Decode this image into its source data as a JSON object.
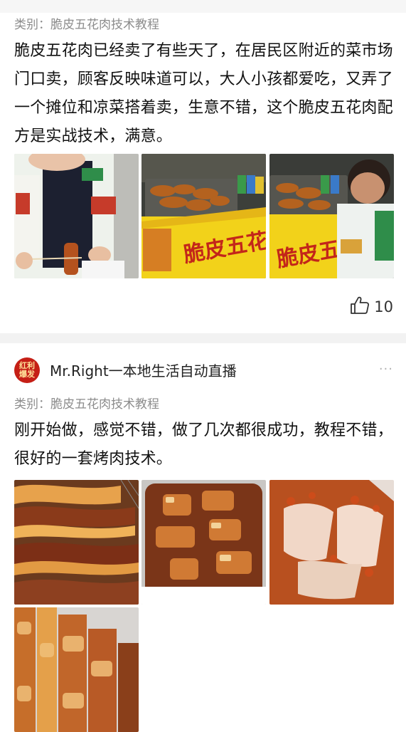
{
  "review1": {
    "category": "类别：脆皮五花肉技术教程",
    "text": "脆皮五花肉已经卖了有些天了，在居民区附近的菜市场门口卖，顾客反映味道可以，大人小孩都爱吃，又弄了一个摊位和凉菜搭着卖，生意不错，这个脆皮五花肉配方是实战技术，满意。",
    "stall_sign": "脆皮五花肉",
    "stall_sign_2": "脆皮五",
    "like_count": "10"
  },
  "review2": {
    "avatar_text": "红利爆发",
    "username": "Mr.Right一本地生活自动直播",
    "more": "···",
    "category": "类别：脆皮五花肉技术教程",
    "text": "刚开始做，感觉不错，做了几次都很成功，教程不错，很好的一套烤肉技术。"
  },
  "colors": {
    "meta_gray": "#8c8c8c",
    "pork_skin": "#d9893a",
    "pork_dark": "#7a2f16",
    "stall_yellow": "#f2d21a"
  }
}
